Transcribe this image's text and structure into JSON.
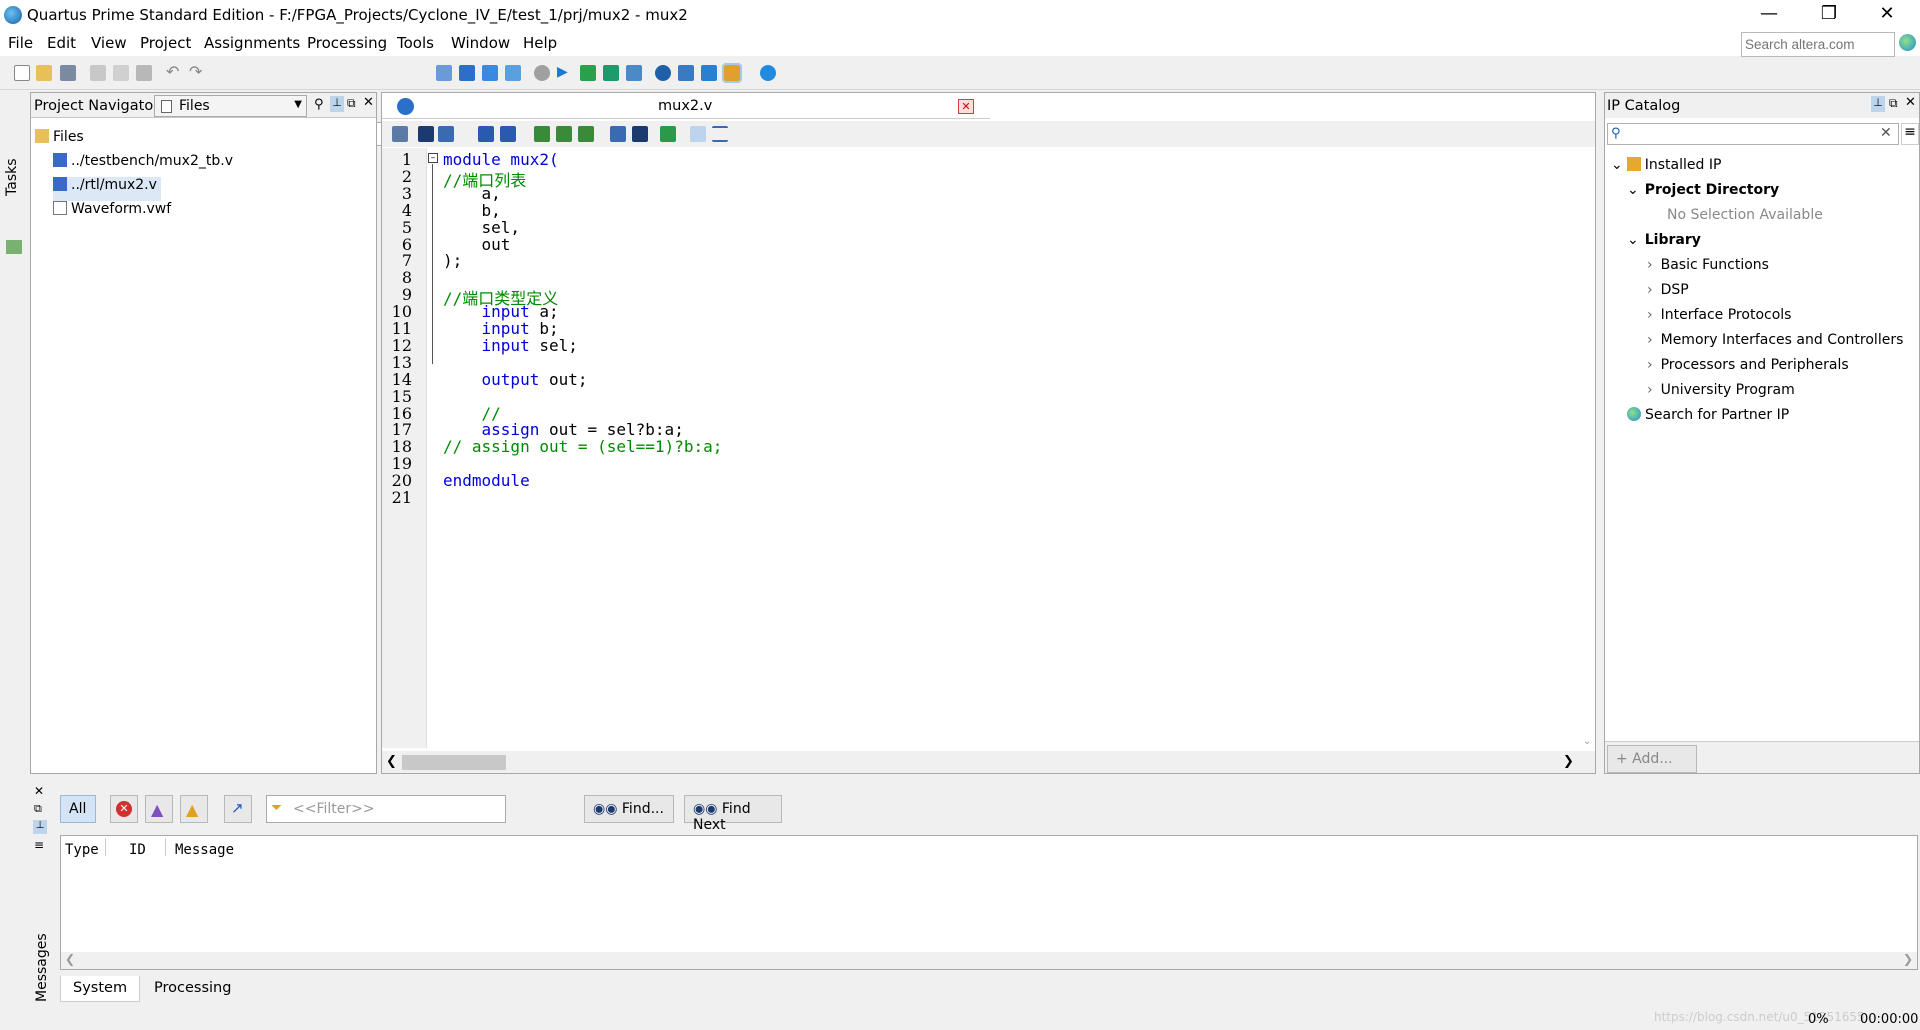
{
  "window": {
    "title": "Quartus Prime Standard Edition - F:/FPGA_Projects/Cyclone_IV_E/test_1/prj/mux2 - mux2"
  },
  "menu": [
    "File",
    "Edit",
    "View",
    "Project",
    "Assignments",
    "Processing",
    "Tools",
    "Window",
    "Help"
  ],
  "search": {
    "placeholder": "Search altera.com"
  },
  "toolbar": {
    "entity": "mux2"
  },
  "tasks": {
    "label": "Tasks"
  },
  "navigator": {
    "title": "Project Navigator",
    "view": "Files",
    "root": "Files",
    "files": [
      "../testbench/mux2_tb.v",
      "../rtl/mux2.v",
      "Waveform.vwf"
    ],
    "selected_file": "../rtl/mux2.v"
  },
  "editor": {
    "tab": "mux2.v",
    "lines": [
      {
        "n": "1",
        "text": "module mux2(",
        "cls": "kw"
      },
      {
        "n": "2",
        "text": "//端口列表",
        "cls": "cm"
      },
      {
        "n": "3",
        "text": "    a,",
        "cls": ""
      },
      {
        "n": "4",
        "text": "    b,",
        "cls": ""
      },
      {
        "n": "5",
        "text": "    sel,",
        "cls": ""
      },
      {
        "n": "6",
        "text": "    out",
        "cls": ""
      },
      {
        "n": "7",
        "text": ");",
        "cls": ""
      },
      {
        "n": "8",
        "text": "",
        "cls": ""
      },
      {
        "n": "9",
        "text": "//端口类型定义",
        "cls": "cm"
      },
      {
        "n": "10",
        "text": "    input a;",
        "cls": "in"
      },
      {
        "n": "11",
        "text": "    input b;",
        "cls": "in"
      },
      {
        "n": "12",
        "text": "    input sel;",
        "cls": "in"
      },
      {
        "n": "13",
        "text": "",
        "cls": ""
      },
      {
        "n": "14",
        "text": "    output out;",
        "cls": "out"
      },
      {
        "n": "15",
        "text": "",
        "cls": ""
      },
      {
        "n": "16",
        "text": "    //",
        "cls": "cm"
      },
      {
        "n": "17",
        "text": "    assign out = sel?b:a;",
        "cls": "as"
      },
      {
        "n": "18",
        "text": "// assign out = (sel==1)?b:a;",
        "cls": "cm"
      },
      {
        "n": "19",
        "text": "",
        "cls": ""
      },
      {
        "n": "20",
        "text": "endmodule",
        "cls": "kw"
      },
      {
        "n": "21",
        "text": "",
        "cls": ""
      }
    ]
  },
  "ip_catalog": {
    "title": "IP Catalog",
    "installed": "Installed IP",
    "project_directory": "Project Directory",
    "no_selection": "No Selection Available",
    "library": "Library",
    "library_items": [
      "Basic Functions",
      "DSP",
      "Interface Protocols",
      "Memory Interfaces and Controllers",
      "Processors and Peripherals",
      "University Program"
    ],
    "partner": "Search for Partner IP",
    "add_button": "+ Add..."
  },
  "messages": {
    "all_label": "All",
    "filter_placeholder": "<<Filter>>",
    "find_label": "Find...",
    "find_next_label": "Find Next",
    "columns": [
      "Type",
      "ID",
      "Message"
    ],
    "side_label": "Messages",
    "tabs": [
      "System",
      "Processing"
    ]
  },
  "status": {
    "progress": "0%",
    "time": "00:00:00",
    "watermark": "https://blog.csdn.net/u0_51351655"
  }
}
